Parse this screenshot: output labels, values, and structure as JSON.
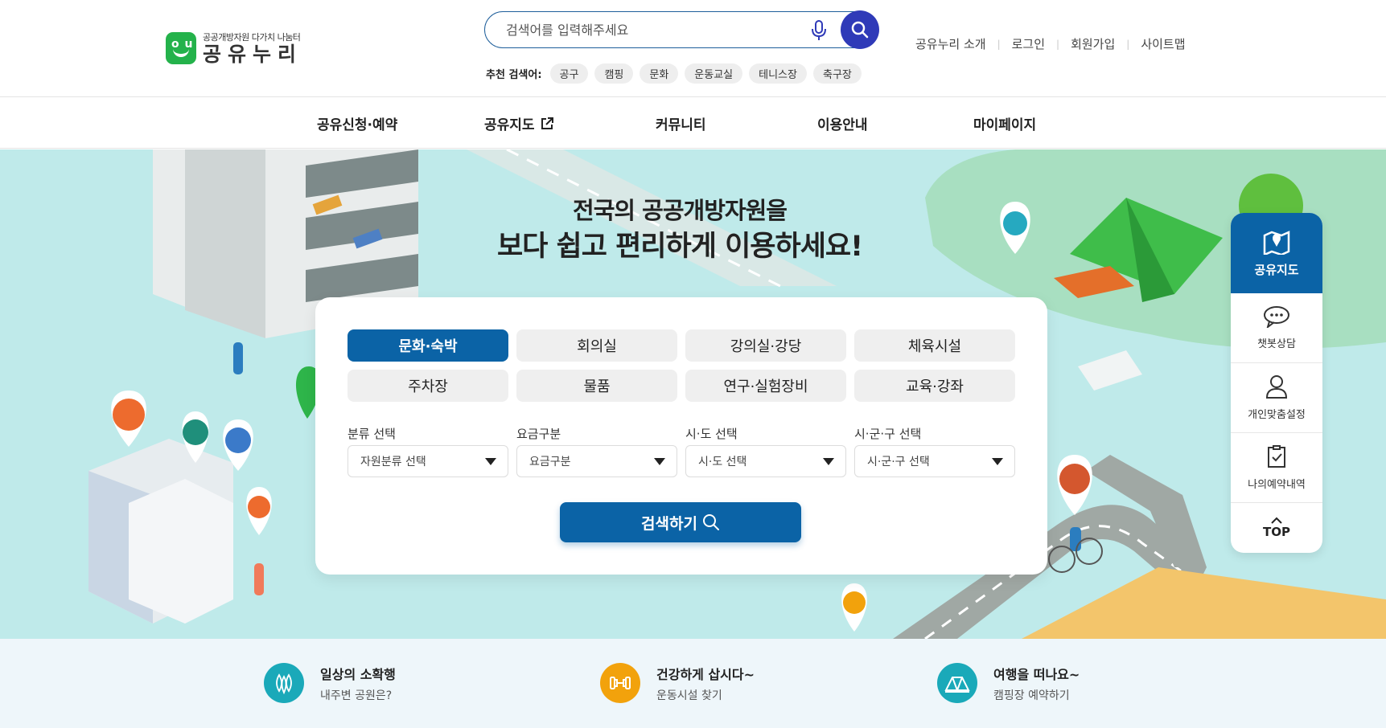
{
  "header": {
    "logo_sub": "공공개방자원 다가치 나눔터",
    "logo_main": "공유누리",
    "search_placeholder": "검색어를 입력해주세요",
    "recommend_label": "추천 검색어:",
    "recommend_tags": [
      "공구",
      "캠핑",
      "문화",
      "운동교실",
      "테니스장",
      "축구장"
    ],
    "util_links": [
      "공유누리 소개",
      "로그인",
      "회원가입",
      "사이트맵"
    ]
  },
  "gnb": {
    "items": [
      "공유신청·예약",
      "공유지도",
      "커뮤니티",
      "이용안내",
      "마이페이지"
    ]
  },
  "hero": {
    "title_line1": "전국의 공공개방자원을",
    "title_line2": "보다 쉽고 편리하게 이용하세요!"
  },
  "panel": {
    "categories": [
      "문화·숙박",
      "회의실",
      "강의실·강당",
      "체육시설",
      "주차장",
      "물품",
      "연구·실험장비",
      "교육·강좌"
    ],
    "active_category": "문화·숙박",
    "filters": [
      {
        "label": "분류 선택",
        "value": "자원분류 선택"
      },
      {
        "label": "요금구분",
        "value": "요금구분"
      },
      {
        "label": "시·도 선택",
        "value": "시·도 선택"
      },
      {
        "label": "시·군·구 선택",
        "value": "시·군·구 선택"
      }
    ],
    "search_button": "검색하기"
  },
  "quick_menu": {
    "top_label": "공유지도",
    "items": [
      "챗봇상담",
      "개인맞춤설정",
      "나의예약내역"
    ],
    "top_button": "TOP"
  },
  "promos": [
    {
      "title": "일상의 소확행",
      "sub": "내주변 공원은?",
      "color": "#1aa9b9",
      "icon": "park-icon"
    },
    {
      "title": "건강하게 삽시다~",
      "sub": "운동시설 찾기",
      "color": "#f2a20c",
      "icon": "dumbbell-icon"
    },
    {
      "title": "여행을 떠나요~",
      "sub": "캠핑장 예약하기",
      "color": "#1aa9b9",
      "icon": "camping-icon"
    }
  ],
  "colors": {
    "primary": "#0b63a6",
    "search_accent": "#2f3ab8",
    "brand_green": "#24b24b"
  }
}
